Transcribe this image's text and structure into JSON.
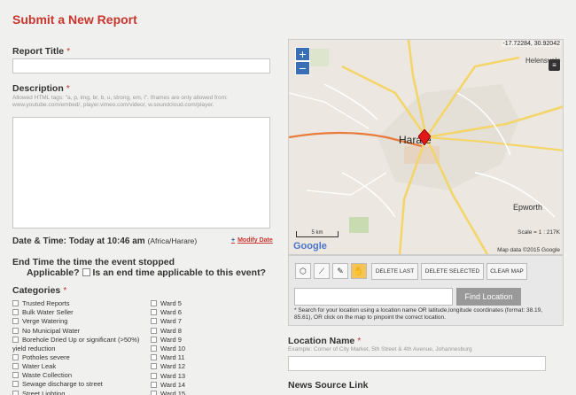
{
  "page_title": "Submit a New Report",
  "report_title": {
    "label": "Report Title",
    "required": "*",
    "value": ""
  },
  "description": {
    "label": "Description",
    "required": "*",
    "note": "Allowed HTML tags: \"a, p, img, br, b, u, strong, em, i\". Iframes are only allowed from: www.youtube.com/embed/, player.vimeo.com/video/, w.soundcloud.com/player.",
    "value": ""
  },
  "datetime": {
    "label": "Date & Time:",
    "value": "Today at 10:46 am",
    "tz": "(Africa/Harare)",
    "modify": "Modify Date",
    "modify_icon": "+"
  },
  "endtime": {
    "line1": "End Time the time the event stopped",
    "line2a": "Applicable?",
    "line2b": "Is an end time applicable to this event?"
  },
  "categories": {
    "label": "Categories",
    "required": "*",
    "col1": [
      "Trusted Reports",
      "Bulk Water Seller",
      "Verge Watering",
      "No Municipal Water",
      "Borehole Dried Up or significant (>50%) yield reduction",
      "Potholes severe",
      "Water Leak",
      "Waste Collection",
      "Sewage discharge to street",
      "Street Lighting"
    ],
    "col2": [
      "Ward 5",
      "Ward 6",
      "Ward 7",
      "Ward 8",
      "Ward 9",
      "Ward 10",
      "Ward 11",
      "Ward 12",
      "Ward 13",
      "Ward 14",
      "Ward 15"
    ]
  },
  "map": {
    "coords": "-17.72284, 30.92042",
    "zoom_in": "+",
    "zoom_out": "−",
    "layers_icon": "layers-icon",
    "city": "Harare",
    "labels": {
      "helensvale": "Helensvale",
      "epworth": "Epworth"
    },
    "roads": [
      "A1",
      "A11",
      "A2",
      "A3",
      "A5",
      "A5",
      "A4",
      "A1",
      "A2",
      "A3"
    ],
    "scale_bar": "5 km",
    "scale": "Scale = 1 : 217K",
    "google": "Google",
    "map_data": "Map data ©2015 Google"
  },
  "tools": {
    "icons": [
      "polygon-icon",
      "line-icon",
      "pencil-icon",
      "hand-icon"
    ],
    "delete_last": "DELETE LAST",
    "delete_selected": "DELETE SELECTED",
    "clear_map": "CLEAR MAP"
  },
  "find": {
    "button": "Find Location",
    "value": "",
    "note": "* Search for your location using a location name OR latitude,longitude coordinates (format: 38.19, 85.61), OR click on the map to pinpoint the correct location."
  },
  "location_name": {
    "label": "Location Name",
    "required": "*",
    "example": "Example: Corner of City Market, 5th Street & 4th Avenue, Johannesburg",
    "value": ""
  },
  "news_source": {
    "label": "News Source Link"
  },
  "colors": {
    "accent": "#c8362d",
    "marker": "#e01818",
    "road_main": "#f4d56a",
    "road_green": "#3d9a3d"
  }
}
